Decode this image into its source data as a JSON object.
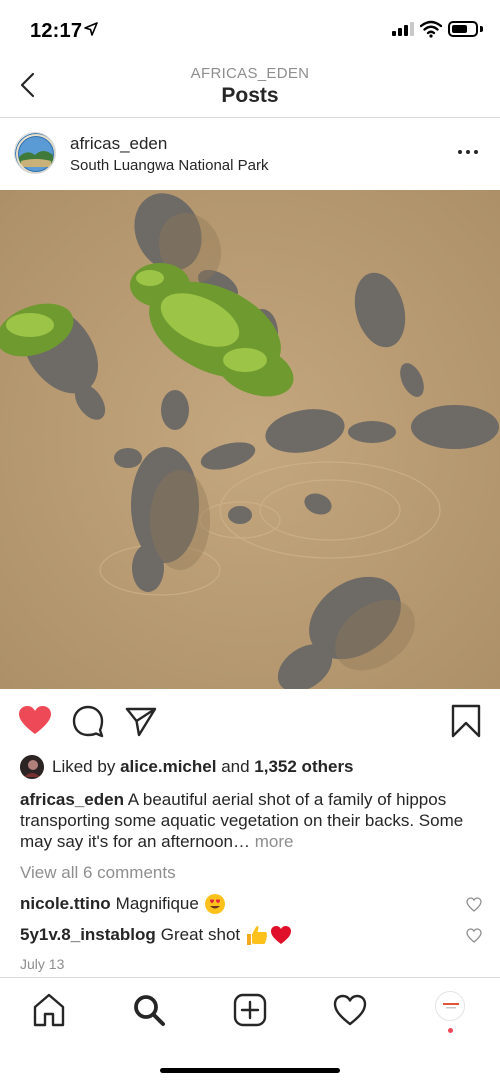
{
  "status_bar": {
    "time": "12:17"
  },
  "header": {
    "subtitle": "AFRICAS_EDEN",
    "title": "Posts"
  },
  "post": {
    "username": "africas_eden",
    "location": "South Luangwa National Park",
    "liked_by_user": "alice.michel",
    "liked_by_joiner": "and",
    "liked_by_prefix": "Liked by",
    "liked_by_others": "1,352 others",
    "caption_user": "africas_eden",
    "caption_text": "A beautiful aerial shot of a family of hippos transporting some aquatic vegetation on their backs. Some may say it's for an afternoon…",
    "caption_more": "more",
    "view_all_comments": "View all 6 comments",
    "comments": [
      {
        "user": "nicole.ttino",
        "text": "Magnifique",
        "emoji": "heart-eyes-emoji"
      },
      {
        "user": "5y1v.8_instablog",
        "text": "Great shot",
        "emoji": "thumbs-up-heart-emoji"
      }
    ],
    "date": "July 13"
  },
  "colors": {
    "like_red": "#ed4956",
    "muted": "#8e8e8e",
    "text": "#262626",
    "water": "#b79a72"
  },
  "icons": {
    "actions": [
      "heart-filled-icon",
      "comment-icon",
      "share-icon",
      "bookmark-icon"
    ],
    "tabs": [
      "home-icon",
      "search-icon",
      "add-post-icon",
      "activity-heart-icon",
      "profile-avatar"
    ]
  }
}
